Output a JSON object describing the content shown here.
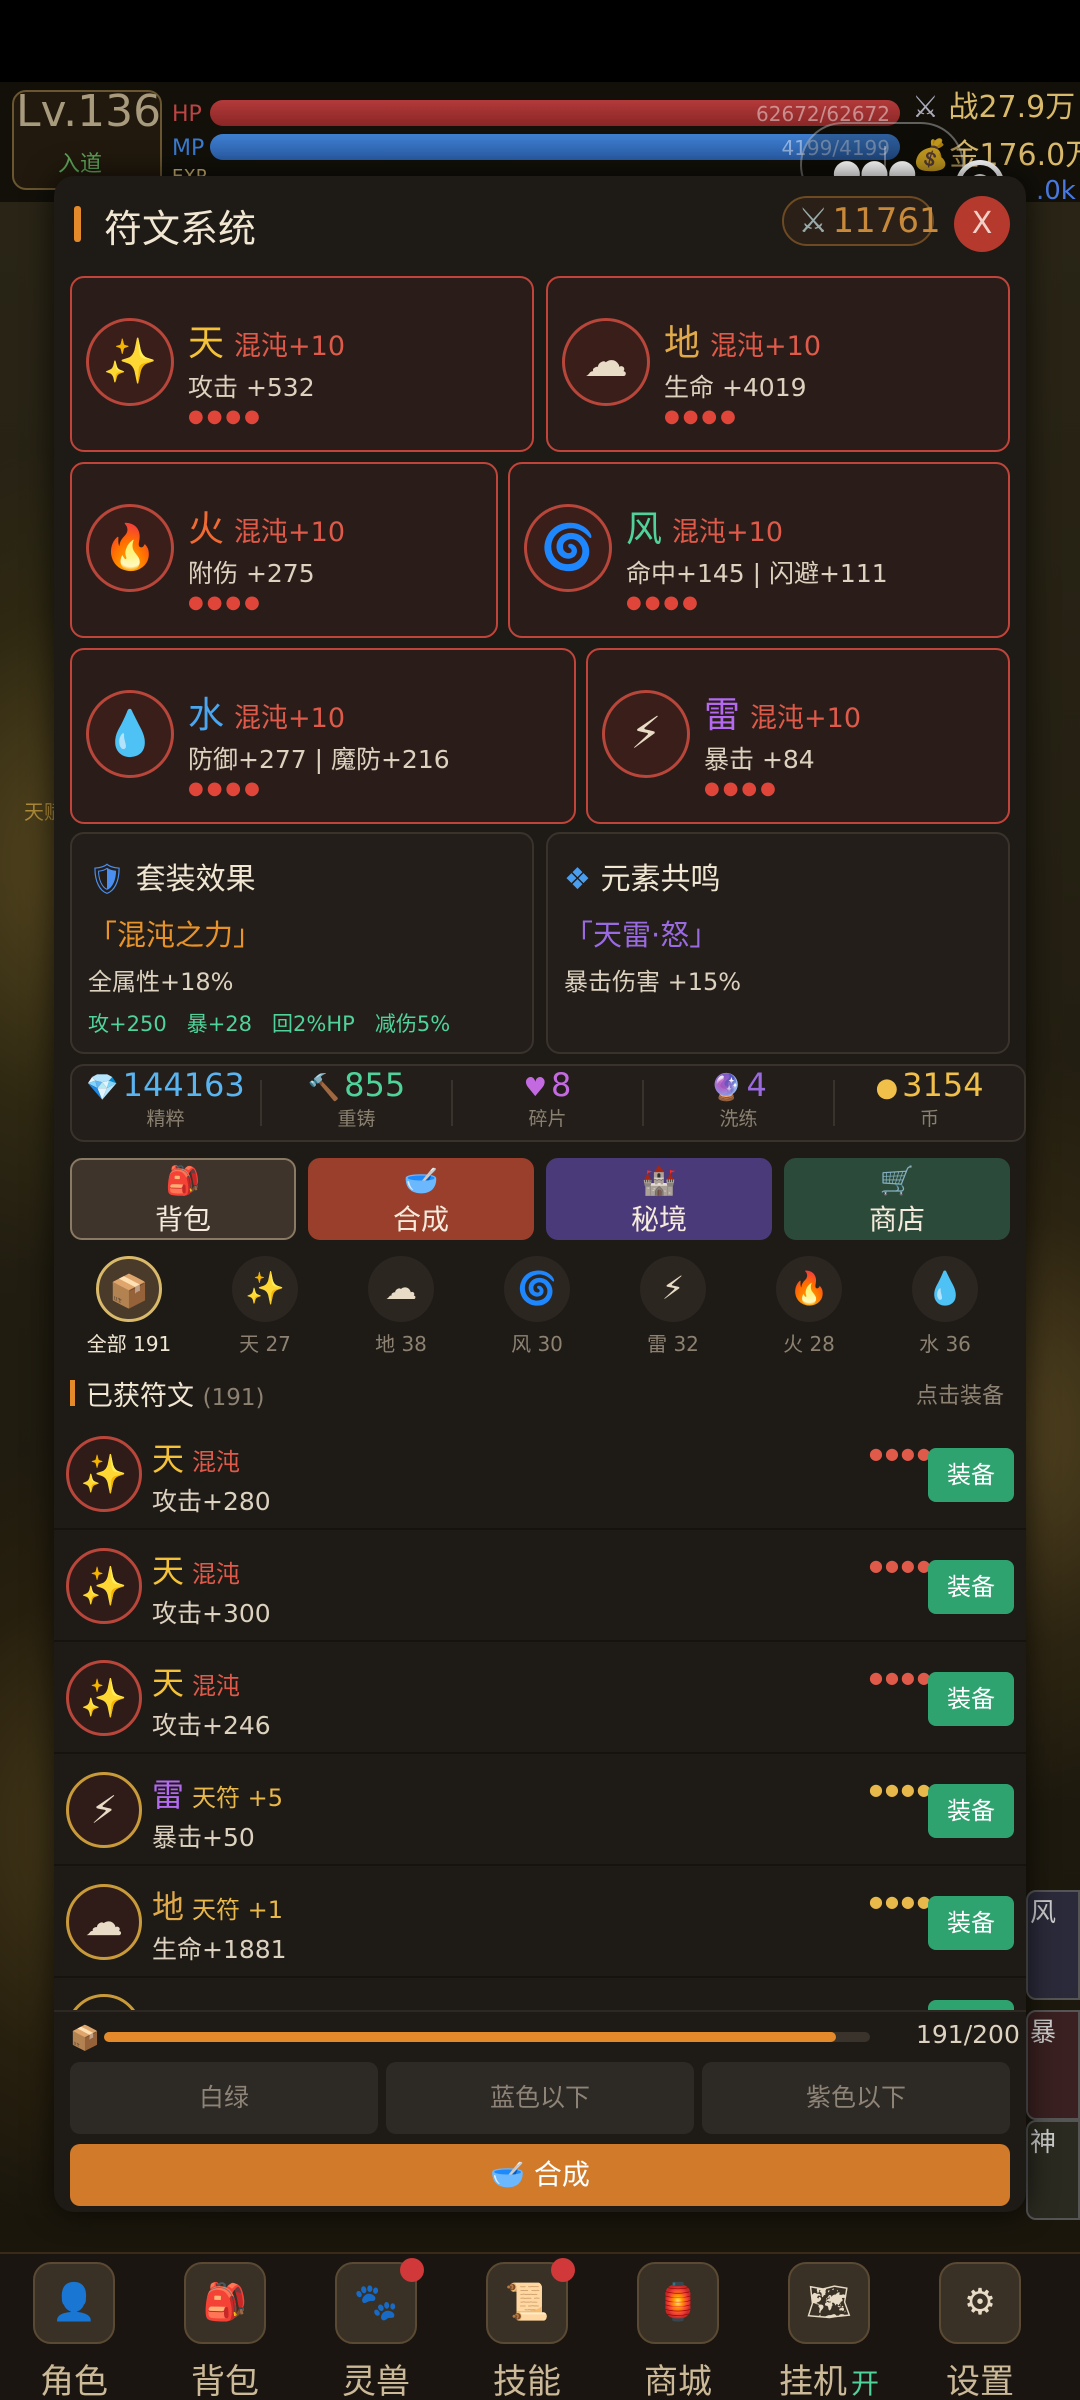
{
  "hud": {
    "level": "Lv.136",
    "realm": "入道",
    "hp_label": "HP",
    "hp_value": "62672/62672",
    "hp_fill": 1.0,
    "mp_label": "MP",
    "mp_value": "4199/4199",
    "mp_fill": 1.0,
    "exp_label": "EXP",
    "power_label": "战",
    "power_value": "27.9万",
    "gold_label": "金",
    "gold_value": "176.0万",
    "right_partial": ".0k",
    "side_text": "天",
    "side_text_2": "天赋"
  },
  "dialog": {
    "title": "符文系统",
    "power": "11761",
    "close_label": "X",
    "slots": [
      {
        "element": "天",
        "grade": "混沌+10",
        "stat": "攻击 +532",
        "dots": "●●●●",
        "icon": "sparkles-icon",
        "name_color": "#f3c13a"
      },
      {
        "element": "地",
        "grade": "混沌+10",
        "stat": "生命 +4019",
        "dots": "●●●●",
        "icon": "cloud-icon",
        "name_color": "#e0a94a"
      },
      {
        "element": "火",
        "grade": "混沌+10",
        "stat": "附伤 +275",
        "dots": "●●●●",
        "icon": "fire-icon",
        "name_color": "#f06a33"
      },
      {
        "element": "风",
        "grade": "混沌+10",
        "stat": "命中+145 | 闪避+111",
        "dots": "●●●●",
        "icon": "cyclone-icon",
        "name_color": "#4fd39a"
      },
      {
        "element": "水",
        "grade": "混沌+10",
        "stat": "防御+277 | 魔防+216",
        "dots": "●●●●",
        "icon": "water-drop-icon",
        "name_color": "#4aa6f0"
      },
      {
        "element": "雷",
        "grade": "混沌+10",
        "stat": "暴击 +84",
        "dots": "●●●●",
        "icon": "lightning-icon",
        "name_color": "#b36af0"
      }
    ],
    "set_effect": {
      "title": "套装效果",
      "name": "「混沌之力」",
      "desc": "全属性+18%",
      "bonuses": "攻+250   暴+28   回2%HP   减伤5%"
    },
    "resonance": {
      "title": "元素共鸣",
      "name": "「天雷·怒」",
      "desc": "暴击伤害 +15%"
    },
    "resources": [
      {
        "value": "144163",
        "label": "精粹",
        "icon": "gem-icon",
        "glyph": "💎",
        "color": "#5ab4f0"
      },
      {
        "value": "855",
        "label": "重铸",
        "icon": "hammer-icon",
        "glyph": "🔨",
        "color": "#4fd39a"
      },
      {
        "value": "8",
        "label": "碎片",
        "icon": "heart-icon",
        "glyph": "♥",
        "color": "#c46ae0"
      },
      {
        "value": "4",
        "label": "洗练",
        "icon": "orb-icon",
        "glyph": "🔮",
        "color": "#9a6ae0"
      },
      {
        "value": "3154",
        "label": "币",
        "icon": "coin-icon",
        "glyph": "●",
        "color": "#f0c04a"
      }
    ],
    "menu": [
      {
        "label": "背包",
        "icon": "backpack-icon",
        "glyph": "🎒",
        "bg": "#3e342b",
        "border": "#8b7a63"
      },
      {
        "label": "合成",
        "icon": "bowl-icon",
        "glyph": "🥣",
        "bg": "#9a3f2c",
        "border": "#9a3f2c"
      },
      {
        "label": "秘境",
        "icon": "castle-icon",
        "glyph": "🏰",
        "bg": "#4b3a79",
        "border": "#4b3a79"
      },
      {
        "label": "商店",
        "icon": "cart-icon",
        "glyph": "🛒",
        "bg": "#2c4a3a",
        "border": "#2c4a3a"
      }
    ],
    "filters": [
      {
        "label": "全部 191",
        "icon": "box-icon",
        "glyph": "📦",
        "active": true
      },
      {
        "label": "天 27",
        "icon": "sparkles-icon",
        "glyph": "✨"
      },
      {
        "label": "地 38",
        "icon": "cloud-icon",
        "glyph": "☁"
      },
      {
        "label": "风 30",
        "icon": "cyclone-icon",
        "glyph": "🌀"
      },
      {
        "label": "雷 32",
        "icon": "lightning-icon",
        "glyph": "⚡"
      },
      {
        "label": "火 28",
        "icon": "fire-icon",
        "glyph": "🔥"
      },
      {
        "label": "水 36",
        "icon": "water-drop-icon",
        "glyph": "💧"
      }
    ],
    "list_title": "已获符文",
    "list_count": "(191)",
    "list_hint": "点击装备",
    "runes": [
      {
        "element": "天",
        "grade": "混沌",
        "stat": "攻击+280",
        "dots": "●●●●",
        "icon": "sparkles-icon",
        "glyph": "✨",
        "name_color": "#f3c13a",
        "grade_color": "#e05a4a",
        "border": "#b8463a",
        "equip": "装备"
      },
      {
        "element": "天",
        "grade": "混沌",
        "stat": "攻击+300",
        "dots": "●●●●",
        "icon": "sparkles-icon",
        "glyph": "✨",
        "name_color": "#f3c13a",
        "grade_color": "#e05a4a",
        "border": "#b8463a",
        "equip": "装备"
      },
      {
        "element": "天",
        "grade": "混沌",
        "stat": "攻击+246",
        "dots": "●●●●",
        "icon": "sparkles-icon",
        "glyph": "✨",
        "name_color": "#f3c13a",
        "grade_color": "#e05a4a",
        "border": "#b8463a",
        "equip": "装备"
      },
      {
        "element": "雷",
        "grade": "天符 +5",
        "stat": "暴击+50",
        "dots": "●●●●",
        "icon": "lightning-icon",
        "glyph": "⚡",
        "name_color": "#b36af0",
        "grade_color": "#e8b84a",
        "border": "#c99a3a",
        "equip": "装备"
      },
      {
        "element": "地",
        "grade": "天符 +1",
        "stat": "生命+1881",
        "dots": "●●●●",
        "icon": "cloud-icon",
        "glyph": "☁",
        "name_color": "#e0a94a",
        "grade_color": "#e8b84a",
        "border": "#c99a3a",
        "equip": "装备"
      }
    ],
    "capacity_text": "191/200",
    "capacity_fill": 0.955,
    "filter_buttons": [
      "白绿",
      "蓝色以下",
      "紫色以下"
    ],
    "synth_label": "合成"
  },
  "right_side": {
    "t1": "风",
    "t2": "暴",
    "t3": "神"
  },
  "bottom_nav": [
    {
      "label": "角色",
      "icon": "character-icon",
      "glyph": "👤"
    },
    {
      "label": "背包",
      "icon": "backpack-icon",
      "glyph": "🎒"
    },
    {
      "label": "灵兽",
      "icon": "paw-icon",
      "glyph": "🐾",
      "badge": true
    },
    {
      "label": "技能",
      "icon": "scroll-icon",
      "glyph": "📜",
      "badge": true
    },
    {
      "label": "商城",
      "icon": "shop-icon",
      "glyph": "🏮"
    },
    {
      "label": "挂机",
      "icon": "map-icon",
      "glyph": "🗺",
      "suffix": "开"
    },
    {
      "label": "设置",
      "icon": "gear-icon",
      "glyph": "⚙"
    }
  ]
}
